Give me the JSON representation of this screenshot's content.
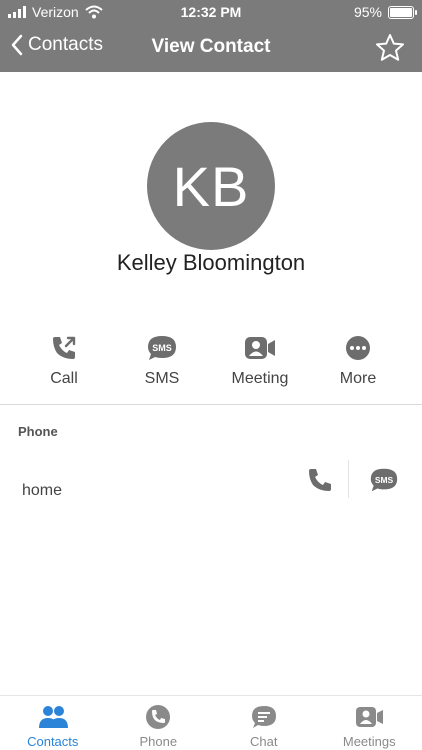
{
  "status": {
    "carrier": "Verizon",
    "time": "12:32 PM",
    "battery": "95%"
  },
  "header": {
    "back_label": "Contacts",
    "title": "View Contact"
  },
  "contact": {
    "initials": "KB",
    "name": "Kelley Bloomington"
  },
  "actions": [
    {
      "label": "Call",
      "icon": "call-icon"
    },
    {
      "label": "SMS",
      "icon": "sms-icon"
    },
    {
      "label": "Meeting",
      "icon": "meeting-icon"
    },
    {
      "label": "More",
      "icon": "more-icon"
    }
  ],
  "phone_section": {
    "title": "Phone",
    "entries": [
      {
        "label": "home"
      }
    ]
  },
  "sms_badge_text": "SMS",
  "tabs": [
    {
      "label": "Contacts",
      "icon": "contacts-icon",
      "active": true
    },
    {
      "label": "Phone",
      "icon": "phone-icon",
      "active": false
    },
    {
      "label": "Chat",
      "icon": "chat-icon",
      "active": false
    },
    {
      "label": "Meetings",
      "icon": "meetings-icon",
      "active": false
    }
  ],
  "colors": {
    "header_bg": "#7b7b7b",
    "accent": "#2b84d8",
    "icon_gray": "#6d6d6d"
  }
}
